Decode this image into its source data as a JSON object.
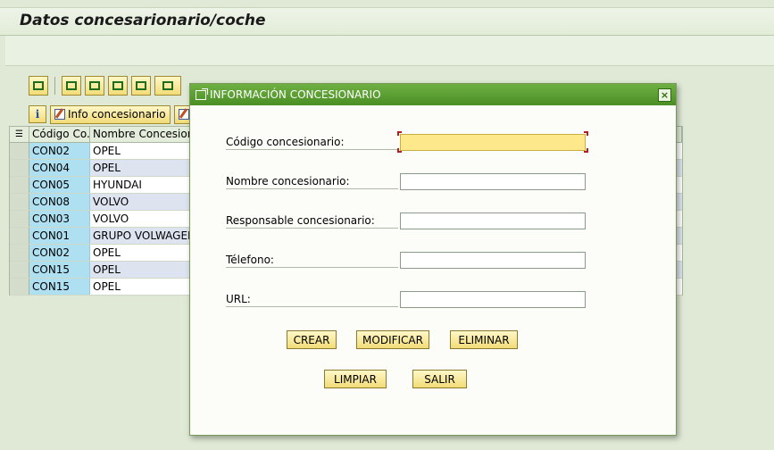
{
  "window": {
    "title": "Datos concesarionario/coche"
  },
  "toolbar2": {
    "info_button_label": "Info concesionario",
    "second_button_label": "I"
  },
  "grid": {
    "headers": [
      "Código Co...",
      "Nombre Concesionar"
    ],
    "rows": [
      {
        "code": "CON02",
        "name": "OPEL"
      },
      {
        "code": "CON04",
        "name": "OPEL"
      },
      {
        "code": "CON05",
        "name": "HYUNDAI"
      },
      {
        "code": "CON08",
        "name": "VOLVO"
      },
      {
        "code": "CON03",
        "name": "VOLVO"
      },
      {
        "code": "CON01",
        "name": "GRUPO VOLWAGEN"
      },
      {
        "code": "CON02",
        "name": "OPEL"
      },
      {
        "code": "CON15",
        "name": "OPEL"
      },
      {
        "code": "CON15",
        "name": "OPEL"
      }
    ]
  },
  "dialog": {
    "title": "INFORMACIÓN CONCESIONARIO",
    "close_label": "×",
    "fields": [
      {
        "label": "Código concesionario:",
        "value": ""
      },
      {
        "label": "Nombre concesionario:",
        "value": ""
      },
      {
        "label": "Responsable concesionario:",
        "value": ""
      },
      {
        "label": "Télefono:",
        "value": ""
      },
      {
        "label": "URL:",
        "value": ""
      }
    ],
    "buttons": {
      "crear": "CREAR",
      "modificar": "MODIFICAR",
      "eliminar": "ELIMINAR",
      "limpiar": "LIMPIAR",
      "salir": "SALIR"
    }
  },
  "colors": {
    "dialog_title_bg": "#5a9e30",
    "input_focus": "#fde88c",
    "code_column_bg": "#aee0f2",
    "alt_row_bg": "#dde4f0"
  }
}
